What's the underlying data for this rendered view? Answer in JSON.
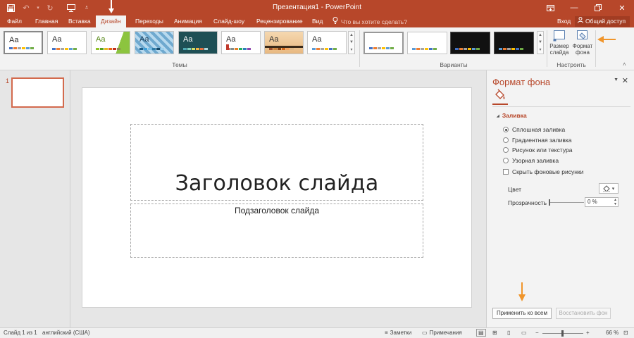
{
  "window": {
    "title": "Презентация1 - PowerPoint"
  },
  "tabs": [
    {
      "label": "Файл",
      "active": false
    },
    {
      "label": "Главная",
      "active": false
    },
    {
      "label": "Вставка",
      "active": false
    },
    {
      "label": "Дизайн",
      "active": true
    },
    {
      "label": "Переходы",
      "active": false
    },
    {
      "label": "Анимация",
      "active": false
    },
    {
      "label": "Слайд-шоу",
      "active": false
    },
    {
      "label": "Рецензирование",
      "active": false
    },
    {
      "label": "Вид",
      "active": false
    }
  ],
  "search": {
    "placeholder": "Что вы хотите сделать?"
  },
  "account": {
    "signin": "Вход",
    "share": "Общий доступ"
  },
  "ribbon": {
    "themes_label": "Темы",
    "themes": [
      {
        "text": "Aa",
        "style": "Office"
      },
      {
        "text": "Aa",
        "style": "Office 2"
      },
      {
        "text": "Aa",
        "style": "Green facet"
      },
      {
        "text": "Aa",
        "style": "Pattern"
      },
      {
        "text": "Aa",
        "style": "Teal dark"
      },
      {
        "text": "Aa",
        "style": "Red accent"
      },
      {
        "text": "Aa",
        "style": "Wood"
      },
      {
        "text": "Aa",
        "style": "Plain"
      }
    ],
    "variants_label": "Варианты",
    "customize_label": "Настроить",
    "slide_size": "Размер слайда",
    "format_bg": "Формат фона"
  },
  "thumbnails": {
    "slide_number": "1"
  },
  "slide": {
    "title": "Заголовок слайда",
    "subtitle": "Подзаголовок слайда"
  },
  "format_pane": {
    "title": "Формат фона",
    "section": "Заливка",
    "options": [
      {
        "label": "Сплошная заливка",
        "selected": true
      },
      {
        "label": "Градиентная заливка",
        "selected": false
      },
      {
        "label": "Рисунок или текстура",
        "selected": false
      },
      {
        "label": "Узорная заливка",
        "selected": false
      }
    ],
    "hide_bg": "Скрыть фоновые рисунки",
    "color_label": "Цвет",
    "transparency_label": "Прозрачность",
    "transparency_value": "0 %",
    "apply_all": "Применить ко всем",
    "reset": "Восстановить фон"
  },
  "status": {
    "slide_info": "Слайд 1 из 1",
    "language": "английский (США)",
    "notes": "Заметки",
    "comments": "Примечания",
    "zoom": "66 %"
  },
  "colors": {
    "accent": "#b7472a",
    "arrow": "#f0952b"
  }
}
